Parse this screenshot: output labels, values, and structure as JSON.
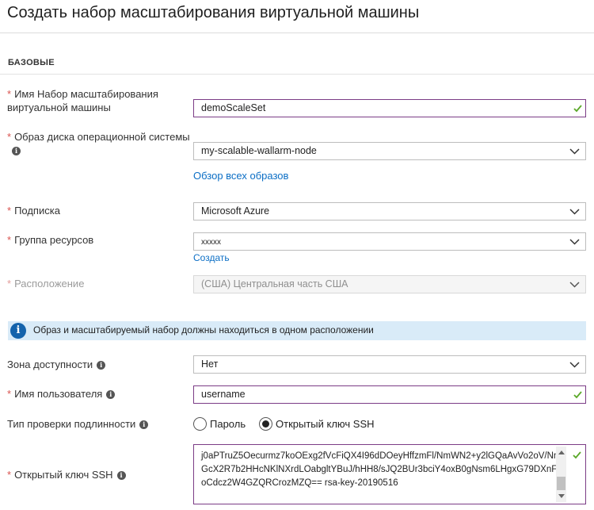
{
  "title": "Создать набор масштабирования виртуальной машины",
  "section": "БАЗОВЫЕ",
  "required_mark": "*",
  "info_glyph": "i",
  "fields": {
    "scale_set_name": {
      "label_line1": "Имя Набор масштабирования",
      "label_line2": "виртуальной машины",
      "value": "demoScaleSet"
    },
    "os_image": {
      "label": "Образ диска операционной системы",
      "value": "my-scalable-wallarm-node",
      "link": "Обзор всех образов"
    },
    "subscription": {
      "label": "Подписка",
      "value": "Microsoft Azure"
    },
    "resource_group": {
      "label": "Группа ресурсов",
      "value": "xxxxx",
      "link": "Создать"
    },
    "location": {
      "label": "Расположение",
      "value": "(США) Центральная часть США"
    },
    "availability_zone": {
      "label": "Зона доступности",
      "value": "Нет"
    },
    "username": {
      "label": "Имя пользователя",
      "value": "username"
    },
    "auth_type": {
      "label": "Тип проверки подлинности",
      "options": [
        "Пароль",
        "Открытый ключ SSH"
      ],
      "selected": "Открытый ключ SSH"
    },
    "ssh_key": {
      "label": "Открытый ключ SSH",
      "value": "j0aPTruZ5Oecurmz7koOExg2fVcFiQX4I96dDOeyHffzmFl/NmWN2+y2lGQaAvVo2oV/NnGcX2R7b2HHcNKlNXrdLOabgltYBuJ/hHH8/sJQ2BUr3bciY4oxB0gNsm6LHgxG79DXnFoCdcz2W4GZQRCrozMZQ== rsa-key-20190516"
    }
  },
  "banner": {
    "text": "Образ и масштабируемый набор должны находиться в одном расположении",
    "icon": "info-icon"
  },
  "colors": {
    "accent_border": "#7b3c86",
    "link": "#0b6ec5",
    "required": "#d9534f",
    "valid_check": "#5ba829",
    "banner_bg": "#d9ebf8"
  }
}
